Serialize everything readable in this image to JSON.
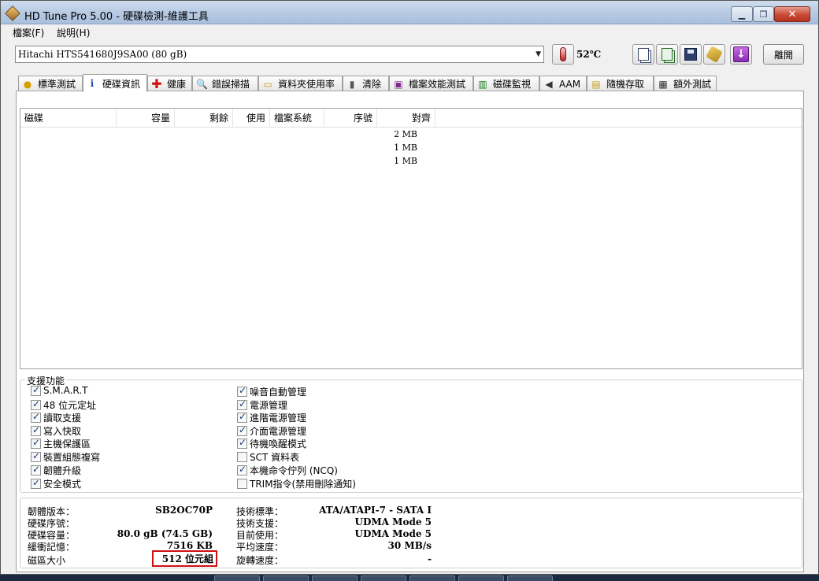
{
  "window": {
    "title": "HD Tune Pro  5.00 - 硬碟檢測-維護工具"
  },
  "menu": {
    "items": [
      "檔案(F)",
      "說明(H)"
    ]
  },
  "toolbar": {
    "drive": "Hitachi HTS541680J9SA00 (80 gB)",
    "temperature": "52℃",
    "exit_label": "離開",
    "buttons": [
      "copy-text-icon",
      "copy-screenshot-icon",
      "save-icon",
      "options-icon",
      "download-icon"
    ]
  },
  "tabs": [
    {
      "label": "標準測試",
      "icon": "benchmark-icon"
    },
    {
      "label": "硬碟資訊",
      "icon": "info-icon"
    },
    {
      "label": "健康",
      "icon": "health-icon"
    },
    {
      "label": "錯誤掃描",
      "icon": "error-scan-icon"
    },
    {
      "label": "資料夾使用率",
      "icon": "folder-usage-icon"
    },
    {
      "label": "清除",
      "icon": "erase-icon"
    },
    {
      "label": "檔案效能測試",
      "icon": "file-benchmark-icon"
    },
    {
      "label": "磁碟監視",
      "icon": "disk-monitor-icon"
    },
    {
      "label": "AAM",
      "icon": "aam-icon"
    },
    {
      "label": "隨機存取",
      "icon": "random-access-icon"
    },
    {
      "label": "額外測試",
      "icon": "extra-tests-icon"
    }
  ],
  "active_tab": "硬碟資訊",
  "partitions": {
    "columns": [
      "磁碟",
      "容量",
      "剩餘",
      "使用",
      "檔案系統",
      "序號",
      "對齊"
    ],
    "rows": [
      {
        "alignment": "2 MB"
      },
      {
        "alignment": "1 MB"
      },
      {
        "alignment": "1 MB"
      }
    ]
  },
  "features": {
    "title": "支援功能",
    "left": [
      {
        "label": "S.M.A.R.T",
        "checked": true
      },
      {
        "label": "48 位元定址",
        "checked": true
      },
      {
        "label": "讀取支援",
        "checked": true
      },
      {
        "label": "寫入快取",
        "checked": true
      },
      {
        "label": "主機保護區",
        "checked": true
      },
      {
        "label": "裝置組態複寫",
        "checked": true
      },
      {
        "label": "韌體升級",
        "checked": true
      },
      {
        "label": "安全模式",
        "checked": true
      }
    ],
    "right": [
      {
        "label": "噪音自動管理",
        "checked": true
      },
      {
        "label": "電源管理",
        "checked": true
      },
      {
        "label": "進階電源管理",
        "checked": true
      },
      {
        "label": "介面電源管理",
        "checked": true
      },
      {
        "label": "待機喚醒模式",
        "checked": true
      },
      {
        "label": "SCT 資料表",
        "checked": false
      },
      {
        "label": "本機命令佇列 (NCQ)",
        "checked": true
      },
      {
        "label": "TRIM指令(禁用刪除通知)",
        "checked": false
      }
    ]
  },
  "info": {
    "left": [
      {
        "label": "韌體版本：",
        "value": "SB2OC70P"
      },
      {
        "label": "硬碟序號：",
        "value": ""
      },
      {
        "label": "硬碟容量：",
        "value": "80.0 gB (74.5 GB)"
      },
      {
        "label": "緩衝記憶：",
        "value": "7516 KB"
      },
      {
        "label": "磁區大小",
        "value": "512 位元組"
      }
    ],
    "right": [
      {
        "label": "技術標準：",
        "value": "ATA/ATAPI-7 - SATA I"
      },
      {
        "label": "技術支援：",
        "value": "UDMA Mode 5"
      },
      {
        "label": "目前使用：",
        "value": "UDMA Mode 5"
      },
      {
        "label": "平均速度：",
        "value": "30 MB/s"
      },
      {
        "label": "旋轉速度：",
        "value": "-"
      }
    ]
  },
  "colors": {
    "highlight": "#d01010",
    "title_bar": "#b8cbe3",
    "close_button": "#c94a35"
  }
}
